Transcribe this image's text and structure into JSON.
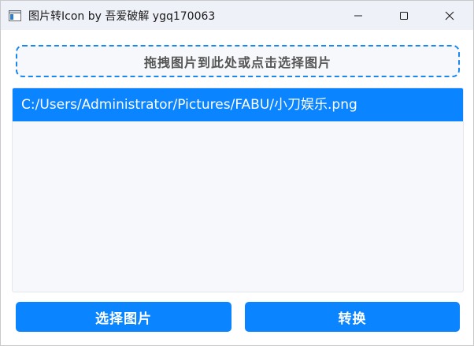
{
  "window": {
    "title": "图片转Icon by 吾爱破解 ygq170063",
    "app_icon": "window-app-icon",
    "controls": {
      "minimize": "minimize-icon",
      "maximize": "maximize-icon",
      "close": "close-icon"
    }
  },
  "dropzone": {
    "label": "拖拽图片到此处或点击选择图片"
  },
  "file_list": {
    "items": [
      {
        "path": "C:/Users/Administrator/Pictures/FABU/小刀娱乐.png",
        "selected": true
      }
    ]
  },
  "buttons": {
    "select_label": "选择图片",
    "convert_label": "转换"
  },
  "colors": {
    "accent": "#0a84ff",
    "dropzone_border": "#1a86f0",
    "titlebar": "#eef1f8"
  }
}
